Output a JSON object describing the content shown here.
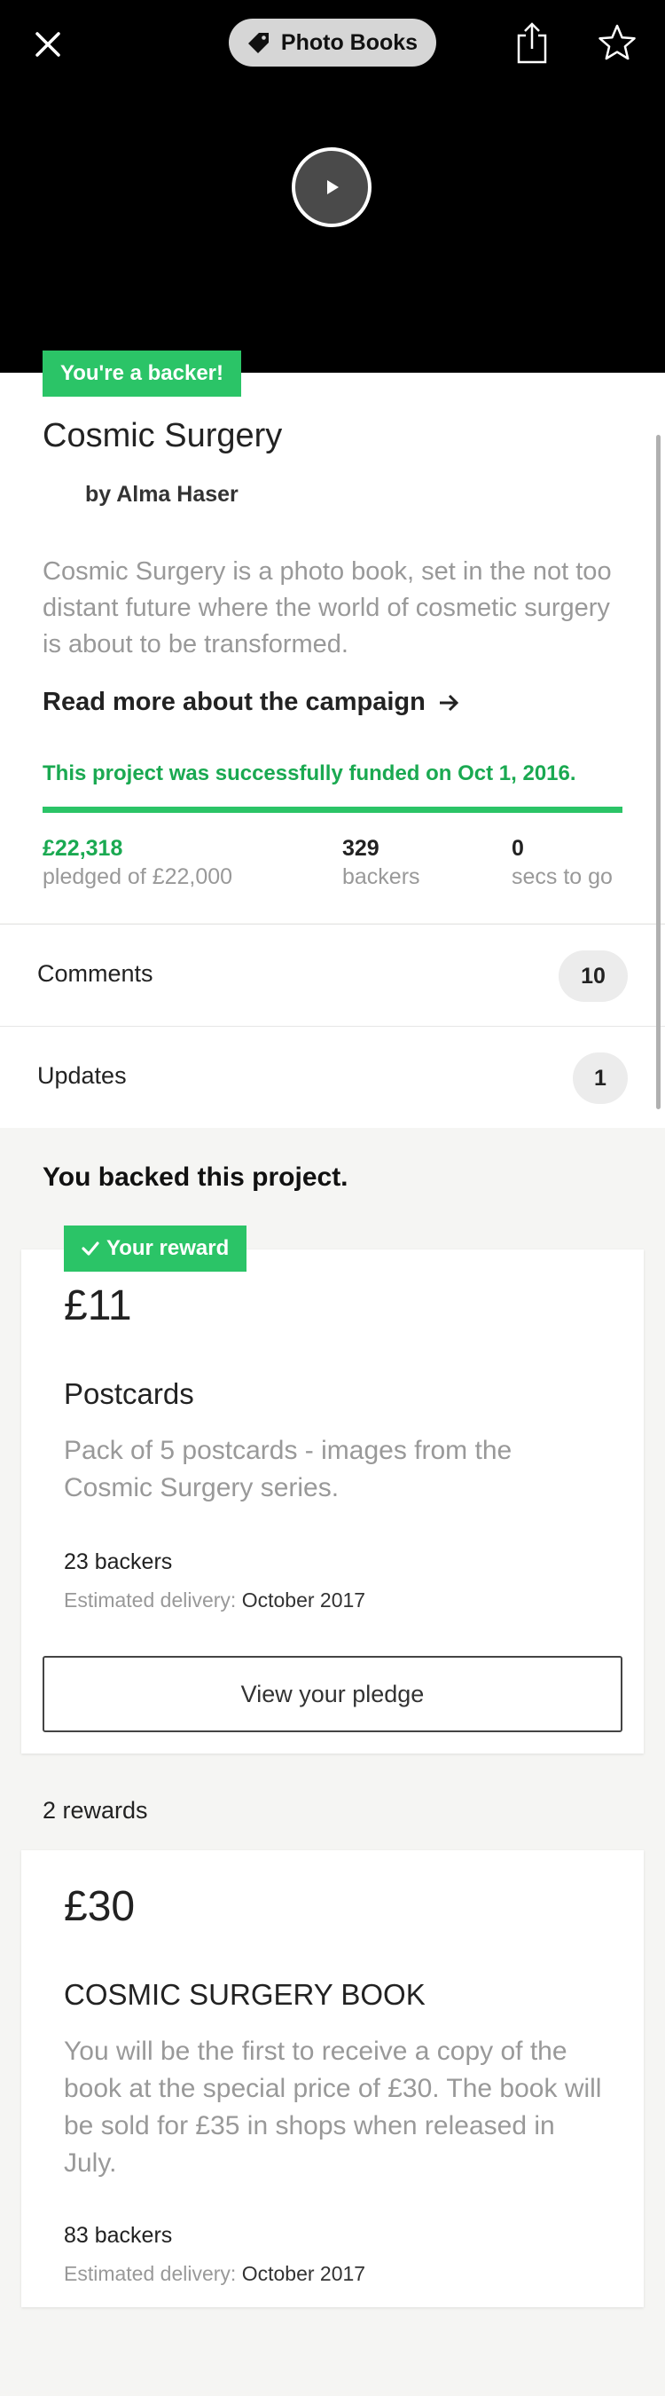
{
  "header": {
    "category_label": "Photo Books",
    "close_icon": "close-icon",
    "tag_icon": "tag-icon",
    "share_icon": "share-icon",
    "star_icon": "star-icon",
    "play_icon": "play-icon"
  },
  "project": {
    "badge": "You're a backer!",
    "title": "Cosmic Surgery",
    "creator": "by Alma Haser",
    "blurb": "Cosmic Surgery is a photo book, set in the not too distant future where the world of cosmetic surgery is about to be transformed.",
    "read_more": "Read more about the campaign",
    "funded_text": "This project was successfully funded on Oct 1, 2016.",
    "progress_fraction": 1.0,
    "stats": {
      "pledged_value": "£22,318",
      "pledged_label": "pledged of £22,000",
      "backers_value": "329",
      "backers_label": "backers",
      "time_value": "0",
      "time_label": "secs to go"
    }
  },
  "rows": {
    "comments_label": "Comments",
    "comments_count": "10",
    "updates_label": "Updates",
    "updates_count": "1"
  },
  "backed": {
    "section_title": "You backed this project.",
    "badge": "Your reward",
    "amount": "£11",
    "title": "Postcards",
    "description": "Pack of 5 postcards - images from the Cosmic Surgery series.",
    "backers": "23 backers",
    "delivery_label": "Estimated delivery:",
    "delivery_value": "October 2017",
    "view_pledge": "View your pledge"
  },
  "rewards": {
    "count_label": "2 rewards",
    "items": [
      {
        "amount": "£30",
        "title": "COSMIC SURGERY BOOK",
        "description": "You will be the first to receive a copy of the book at the special price of £30. The book will be sold for £35 in shops when released in July.",
        "backers": "83 backers",
        "delivery_label": "Estimated delivery:",
        "delivery_value": "October 2017"
      }
    ]
  },
  "colors": {
    "accent_green": "#2bc467",
    "funded_green": "#1aa951",
    "muted_text": "#999999"
  }
}
